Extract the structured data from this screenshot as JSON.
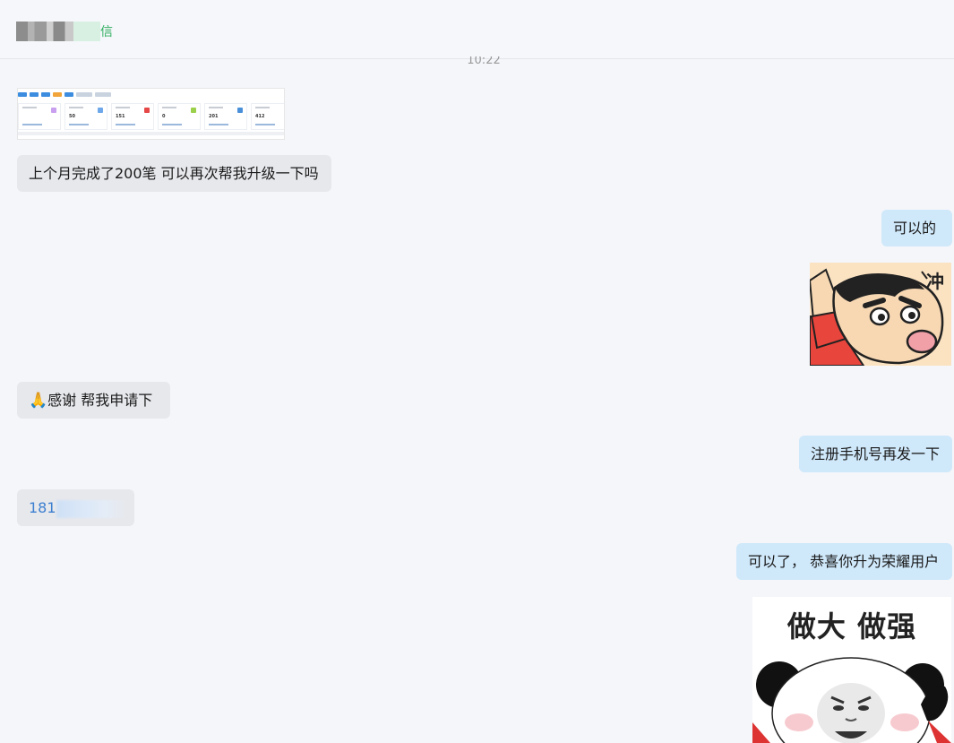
{
  "header": {
    "contact_name_suffix": "信"
  },
  "timestamp": "10:22",
  "messages": [
    {
      "id": "m1",
      "side": "in",
      "type": "image",
      "alt": "dashboard screenshot"
    },
    {
      "id": "m2",
      "side": "in",
      "type": "text",
      "text": "上个月完成了200笔 可以再次帮我升级一下吗"
    },
    {
      "id": "m3",
      "side": "out",
      "type": "text",
      "text": "可以的"
    },
    {
      "id": "m4",
      "side": "out",
      "type": "sticker",
      "alt": "crayon shin-chan sticker"
    },
    {
      "id": "m5",
      "side": "in",
      "type": "text",
      "emoji": "🙏",
      "text": "感谢 帮我申请下"
    },
    {
      "id": "m6",
      "side": "out",
      "type": "text",
      "text": "注册手机号再发一下"
    },
    {
      "id": "m7",
      "side": "in",
      "type": "text",
      "text": "181"
    },
    {
      "id": "m8",
      "side": "out",
      "type": "text",
      "text": "可以了， 恭喜你升为荣耀用户"
    },
    {
      "id": "m9",
      "side": "out",
      "type": "sticker",
      "caption": "做大 做强"
    }
  ],
  "dashboard_shot": {
    "card_values": [
      "50",
      "151",
      "0",
      "201",
      "412"
    ]
  },
  "colors": {
    "background": "#f5f6fa",
    "incoming_bubble": "#e7e8ec",
    "outgoing_bubble": "#cfe8fa",
    "phone_link": "#3d7fd0",
    "name_green": "#2fae5f"
  }
}
